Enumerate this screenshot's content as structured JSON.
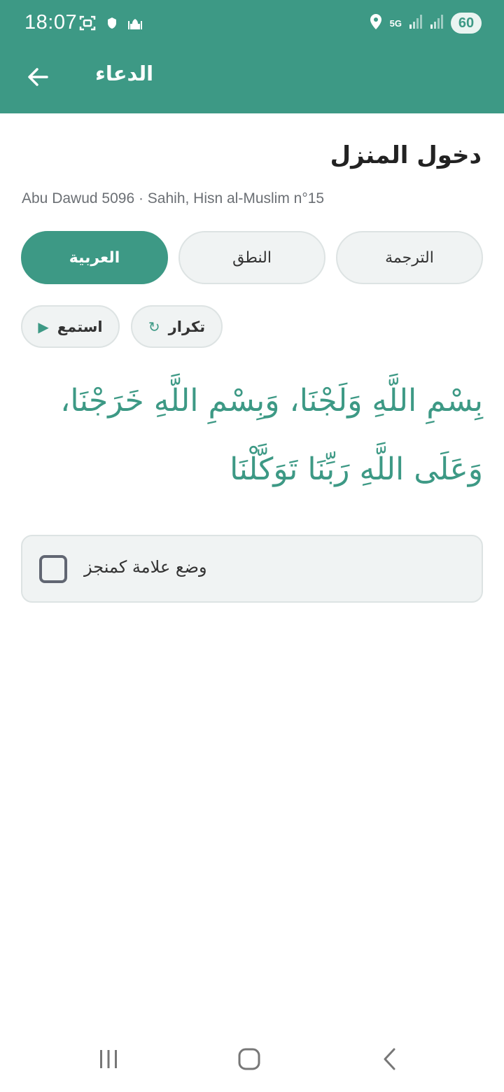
{
  "status_bar": {
    "time": "18:07",
    "network": "5G",
    "battery": "60",
    "icons": [
      "screenshot-icon",
      "shield-icon",
      "mosque-icon",
      "location-icon",
      "signal-icon",
      "signal-icon"
    ]
  },
  "app_bar": {
    "title": "الدعاء",
    "back_icon": "arrow-left-icon"
  },
  "dua": {
    "title": "دخول المنزل",
    "source": "Abu Dawud 5096 · Sahih, Hisn al-Muslim n°15",
    "text": "بِسْمِ اللَّهِ وَلَجْنَا، وَبِسْمِ اللَّهِ خَرَجْنَا، وَعَلَى اللَّهِ رَبِّنَا تَوَكَّلْنَا"
  },
  "tabs": [
    {
      "label": "العربية",
      "active": true
    },
    {
      "label": "النطق",
      "active": false
    },
    {
      "label": "الترجمة",
      "active": false
    }
  ],
  "actions": {
    "listen_label": "استمع",
    "listen_glyph": "▶",
    "repeat_label": "تكرار",
    "repeat_glyph": "↻"
  },
  "mark_done": {
    "label": "وضع علامة كمنجز",
    "checked": false
  },
  "colors": {
    "primary": "#3d9985",
    "surface": "#f0f3f3",
    "border": "#dde3e3",
    "text": "#222222"
  },
  "nav_bar": {
    "icons": [
      "recent-apps-icon",
      "home-icon",
      "back-icon"
    ]
  }
}
